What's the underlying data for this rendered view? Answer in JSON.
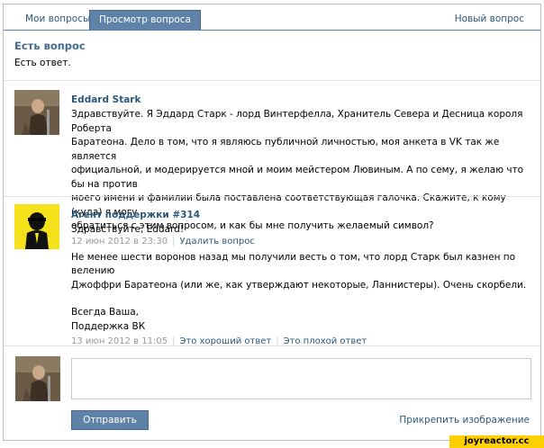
{
  "tabs": {
    "my_questions": "Мои вопросы",
    "view_question": "Просмотр вопроса",
    "new_question": "Новый вопрос"
  },
  "question": {
    "title": "Есть вопрос",
    "status": "Есть ответ."
  },
  "posts": [
    {
      "author": "Eddard Stark",
      "text_lines": [
        "Здравствуйте. Я Эддард Старк - лорд Винтерфелла, Хранитель Севера и Десница короля Роберта",
        "Баратеона. Дело в том, что я являюсь публичной личностью, моя анкета в VK так же является",
        "официальной, и модерируется мной и моим мейстером Лювиным. А по сему, я желаю что бы на против",
        "моего имени и фамилии была поставлена соответствующая галочка. Скажите, к кому (куда) я могу",
        "обратиться с этим вопросом, и как бы мне получить желаемый символ?"
      ],
      "date": "12 июн 2012 в 23:30",
      "action": "Удалить вопрос"
    },
    {
      "author": "Агент поддержки #314",
      "greeting": "Здравствуйте, Eddard!",
      "text_lines": [
        "Не менее шести воронов назад мы получили весть о том, что лорд Старк был казнен по велению",
        "Джоффри Баратеона (или же, как утверждают некоторые, Ланнистеры). Очень скорбели."
      ],
      "sign_lines": [
        "Всегда Ваша,",
        "Поддержка ВК"
      ],
      "date": "13 июн 2012 в 11:05",
      "good": "Это хороший ответ",
      "bad": "Это плохой ответ"
    }
  ],
  "composer": {
    "send": "Отправить",
    "attach": "Прикрепить изображение"
  },
  "watermark": "joyreactor.cc",
  "colors": {
    "accent": "#5e82a8",
    "link": "#2b587a"
  }
}
